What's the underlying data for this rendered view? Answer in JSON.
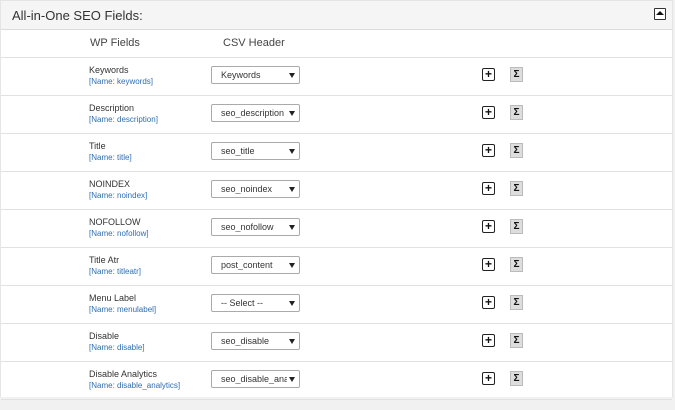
{
  "panel": {
    "title": "All-in-One SEO Fields:"
  },
  "columns": {
    "wp_fields": "WP Fields",
    "csv_header": "CSV Header"
  },
  "icons": {
    "collapse": "collapse-arrow-icon",
    "add": "plus-icon",
    "sum": "sigma-icon"
  },
  "buttons": {
    "plus": "+",
    "sigma": "Σ"
  },
  "rows": [
    {
      "label": "Keywords",
      "key": "[Name: keywords]",
      "selected": "Keywords"
    },
    {
      "label": "Description",
      "key": "[Name: description]",
      "selected": "seo_description"
    },
    {
      "label": "Title",
      "key": "[Name: title]",
      "selected": "seo_title"
    },
    {
      "label": "NOINDEX",
      "key": "[Name: noindex]",
      "selected": "seo_noindex"
    },
    {
      "label": "NOFOLLOW",
      "key": "[Name: nofollow]",
      "selected": "seo_nofollow"
    },
    {
      "label": "Title Atr",
      "key": "[Name: titleatr]",
      "selected": "post_content"
    },
    {
      "label": "Menu Label",
      "key": "[Name: menulabel]",
      "selected": "-- Select --"
    },
    {
      "label": "Disable",
      "key": "[Name: disable]",
      "selected": "seo_disable"
    },
    {
      "label": "Disable Analytics",
      "key": "[Name: disable_analytics]",
      "selected": "seo_disable_analy"
    }
  ]
}
